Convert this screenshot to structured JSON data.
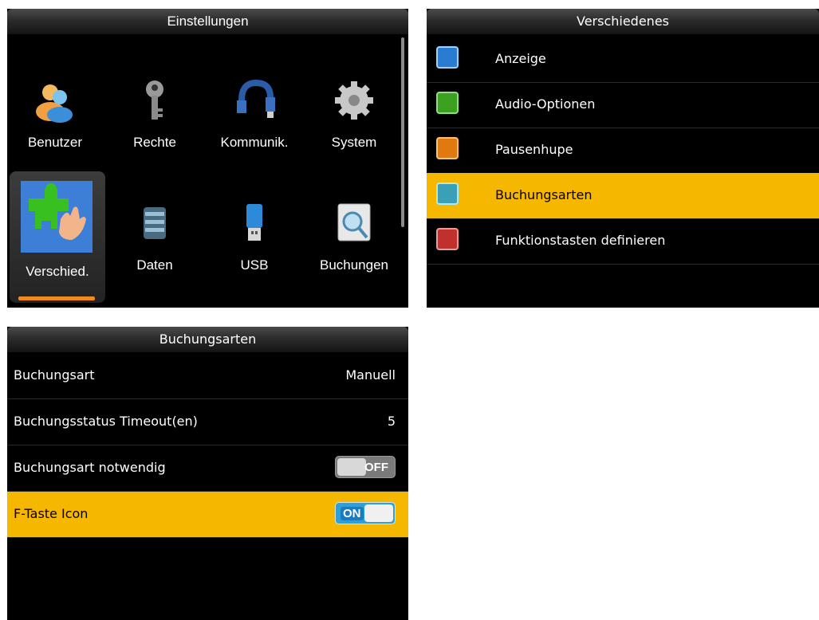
{
  "panel1": {
    "title": "Einstellungen",
    "tiles": [
      {
        "label": "Benutzer",
        "icon": "users-icon"
      },
      {
        "label": "Rechte",
        "icon": "key-icon"
      },
      {
        "label": "Kommunik.",
        "icon": "network-cable-icon"
      },
      {
        "label": "System",
        "icon": "gear-icon"
      },
      {
        "label": "Verschied.",
        "icon": "puzzle-hand-icon",
        "selected": true
      },
      {
        "label": "Daten",
        "icon": "database-icon"
      },
      {
        "label": "USB",
        "icon": "usb-stick-icon"
      },
      {
        "label": "Buchungen",
        "icon": "magnifier-icon"
      }
    ]
  },
  "panel2": {
    "title": "Verschiedenes",
    "items": [
      {
        "label": "Anzeige",
        "icon": "display-icon"
      },
      {
        "label": "Audio-Optionen",
        "icon": "speaker-icon"
      },
      {
        "label": "Pausenhupe",
        "icon": "bell-icon"
      },
      {
        "label": "Buchungsarten",
        "icon": "gear-icon",
        "highlighted": true
      },
      {
        "label": "Funktionstasten definieren",
        "icon": "alt-key-icon"
      }
    ]
  },
  "panel3": {
    "title": "Buchungsarten",
    "rows": [
      {
        "label": "Buchungsart",
        "value": "Manuell"
      },
      {
        "label": "Buchungsstatus Timeout(en)",
        "value": "5"
      },
      {
        "label": "Buchungsart notwendig",
        "toggle": "OFF"
      },
      {
        "label": "F-Taste Icon",
        "toggle": "ON",
        "highlighted": true
      }
    ]
  },
  "colors": {
    "highlight": "#f5b700",
    "accent_bar": "#f08a1c",
    "toggle_on": "#2f9fd8"
  }
}
